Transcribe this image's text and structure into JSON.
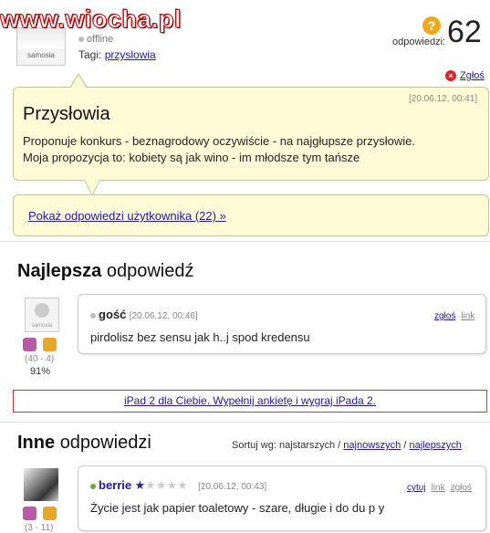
{
  "header": {
    "watermark": "www.wiocha.pl",
    "user_avatar_label": "samosia",
    "status": "offline",
    "tags_label": "Tagi:",
    "tag": "przyslowia",
    "answers_label": "odpowiedzi:",
    "answers_count": "62",
    "report_label": "Zgłoś"
  },
  "question": {
    "date": "[20.06.12, 00:41]",
    "title": "Przysłowia",
    "line1": "Proponuje konkurs - beznagrodowy oczywiście - na najgłupsze przysłowie.",
    "line2": "Moja propozycja to: kobiety są jak wino - im młodsze tym tańsze",
    "show_answers_link": "Pokaż odpowiedzi użytkownika (22) »"
  },
  "best": {
    "heading_bold": "Najlepsza",
    "heading_rest": "odpowiedź",
    "avatar_label": "samosia",
    "author": "gość",
    "date": "[20.06.12, 00:46]",
    "report": "zgłoś",
    "link": "link",
    "text": "pirdolisz bez sensu jak h..j spod kredensu",
    "votes": "(40 - 4)",
    "percent": "91%"
  },
  "ad": {
    "text": "iPad 2 dla Ciebie. Wypełnij ankietę i wygraj iPada 2."
  },
  "others": {
    "heading_bold": "Inne",
    "heading_rest": "odpowiedzi",
    "sort_label": "Sortuj wg: najstarszych /",
    "sort_newest": "najnowszych",
    "sort_sep": "/",
    "sort_best": "najlepszych",
    "first": {
      "author": "berrie",
      "rating": 1,
      "rating_max": 5,
      "date": "[20.06.12, 00:43]",
      "quote": "cytuj",
      "link": "link",
      "report": "zgłoś",
      "text": "Życie jest jak papier toaletowy - szare, długie i do du p y",
      "votes": "(3 - 11)"
    }
  },
  "colors": {
    "bubble_bg": "#fffbd6",
    "link": "#1a1aa6",
    "star_filled": "#1a2a9a",
    "star_empty": "#cccccc"
  }
}
